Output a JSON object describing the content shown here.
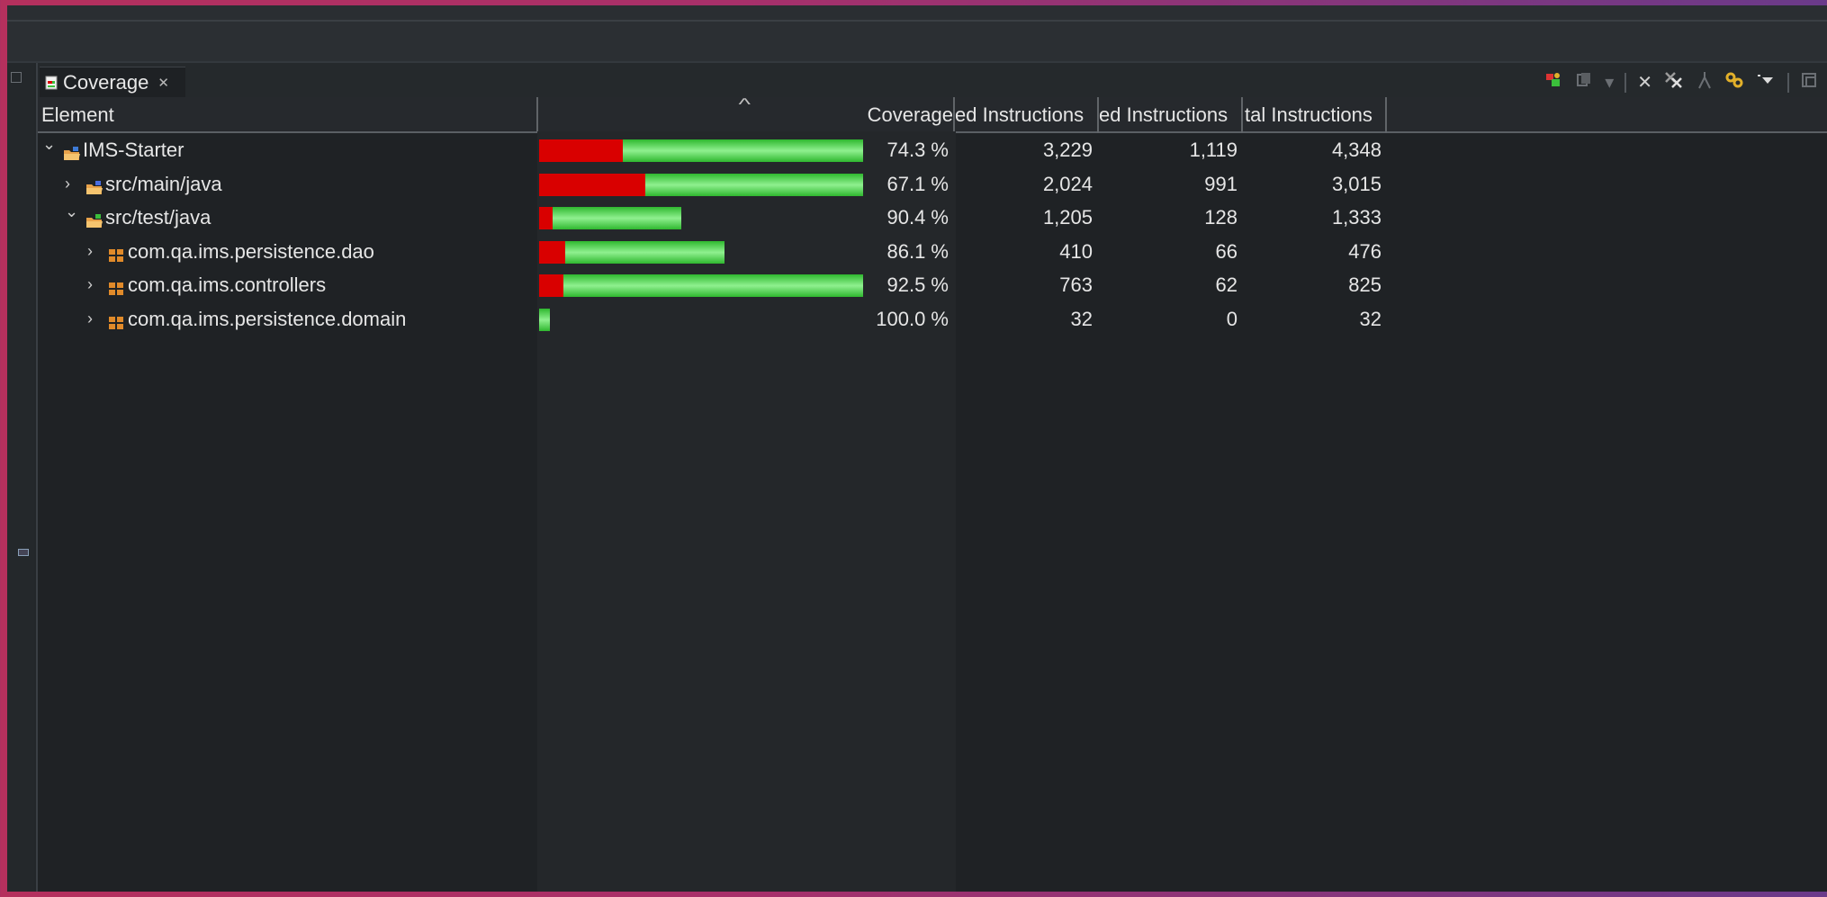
{
  "view": {
    "tab_title": "Coverage",
    "tab_close_glyph": "✕"
  },
  "toolbar": {
    "icons": [
      "relaunch-icon",
      "merge-sessions-icon",
      "dropdown-icon",
      "remove-session-icon",
      "remove-all-sessions-icon",
      "collapse-all-icon",
      "link-with-selection-icon",
      "view-menu-icon",
      "minimize-icon"
    ]
  },
  "columns": {
    "element": "Element",
    "coverage": "Coverage",
    "covered": "ed Instructions",
    "missed": "ed Instructions",
    "total": "tal Instructions"
  },
  "rows": [
    {
      "name": "IMS-Starter",
      "coverage": "74.3 %",
      "covered": "3,229",
      "missed": "1,119",
      "total": "4,348",
      "covered_pct": 74.3,
      "expanded": true,
      "kind": "project"
    },
    {
      "name": "src/main/java",
      "coverage": "67.1 %",
      "covered": "2,024",
      "missed": "991",
      "total": "3,015",
      "covered_pct": 67.1,
      "expanded": false,
      "kind": "source-folder"
    },
    {
      "name": "src/test/java",
      "coverage": "90.4 %",
      "covered": "1,205",
      "missed": "128",
      "total": "1,333",
      "covered_pct": 90.4,
      "expanded": true,
      "kind": "test-folder"
    },
    {
      "name": "com.qa.ims.persistence.dao",
      "coverage": "86.1 %",
      "covered": "410",
      "missed": "66",
      "total": "476",
      "covered_pct": 86.1,
      "expanded": false,
      "kind": "package"
    },
    {
      "name": "com.qa.ims.controllers",
      "coverage": "92.5 %",
      "covered": "763",
      "missed": "62",
      "total": "825",
      "covered_pct": 92.5,
      "expanded": false,
      "kind": "package"
    },
    {
      "name": "com.qa.ims.persistence.domain",
      "coverage": "100.0 %",
      "covered": "32",
      "missed": "0",
      "total": "32",
      "covered_pct": 100.0,
      "expanded": false,
      "kind": "package"
    }
  ],
  "colors": {
    "missed_bar": "#d90000",
    "covered_bar": "#4fd24f",
    "background": "#1f2225"
  }
}
